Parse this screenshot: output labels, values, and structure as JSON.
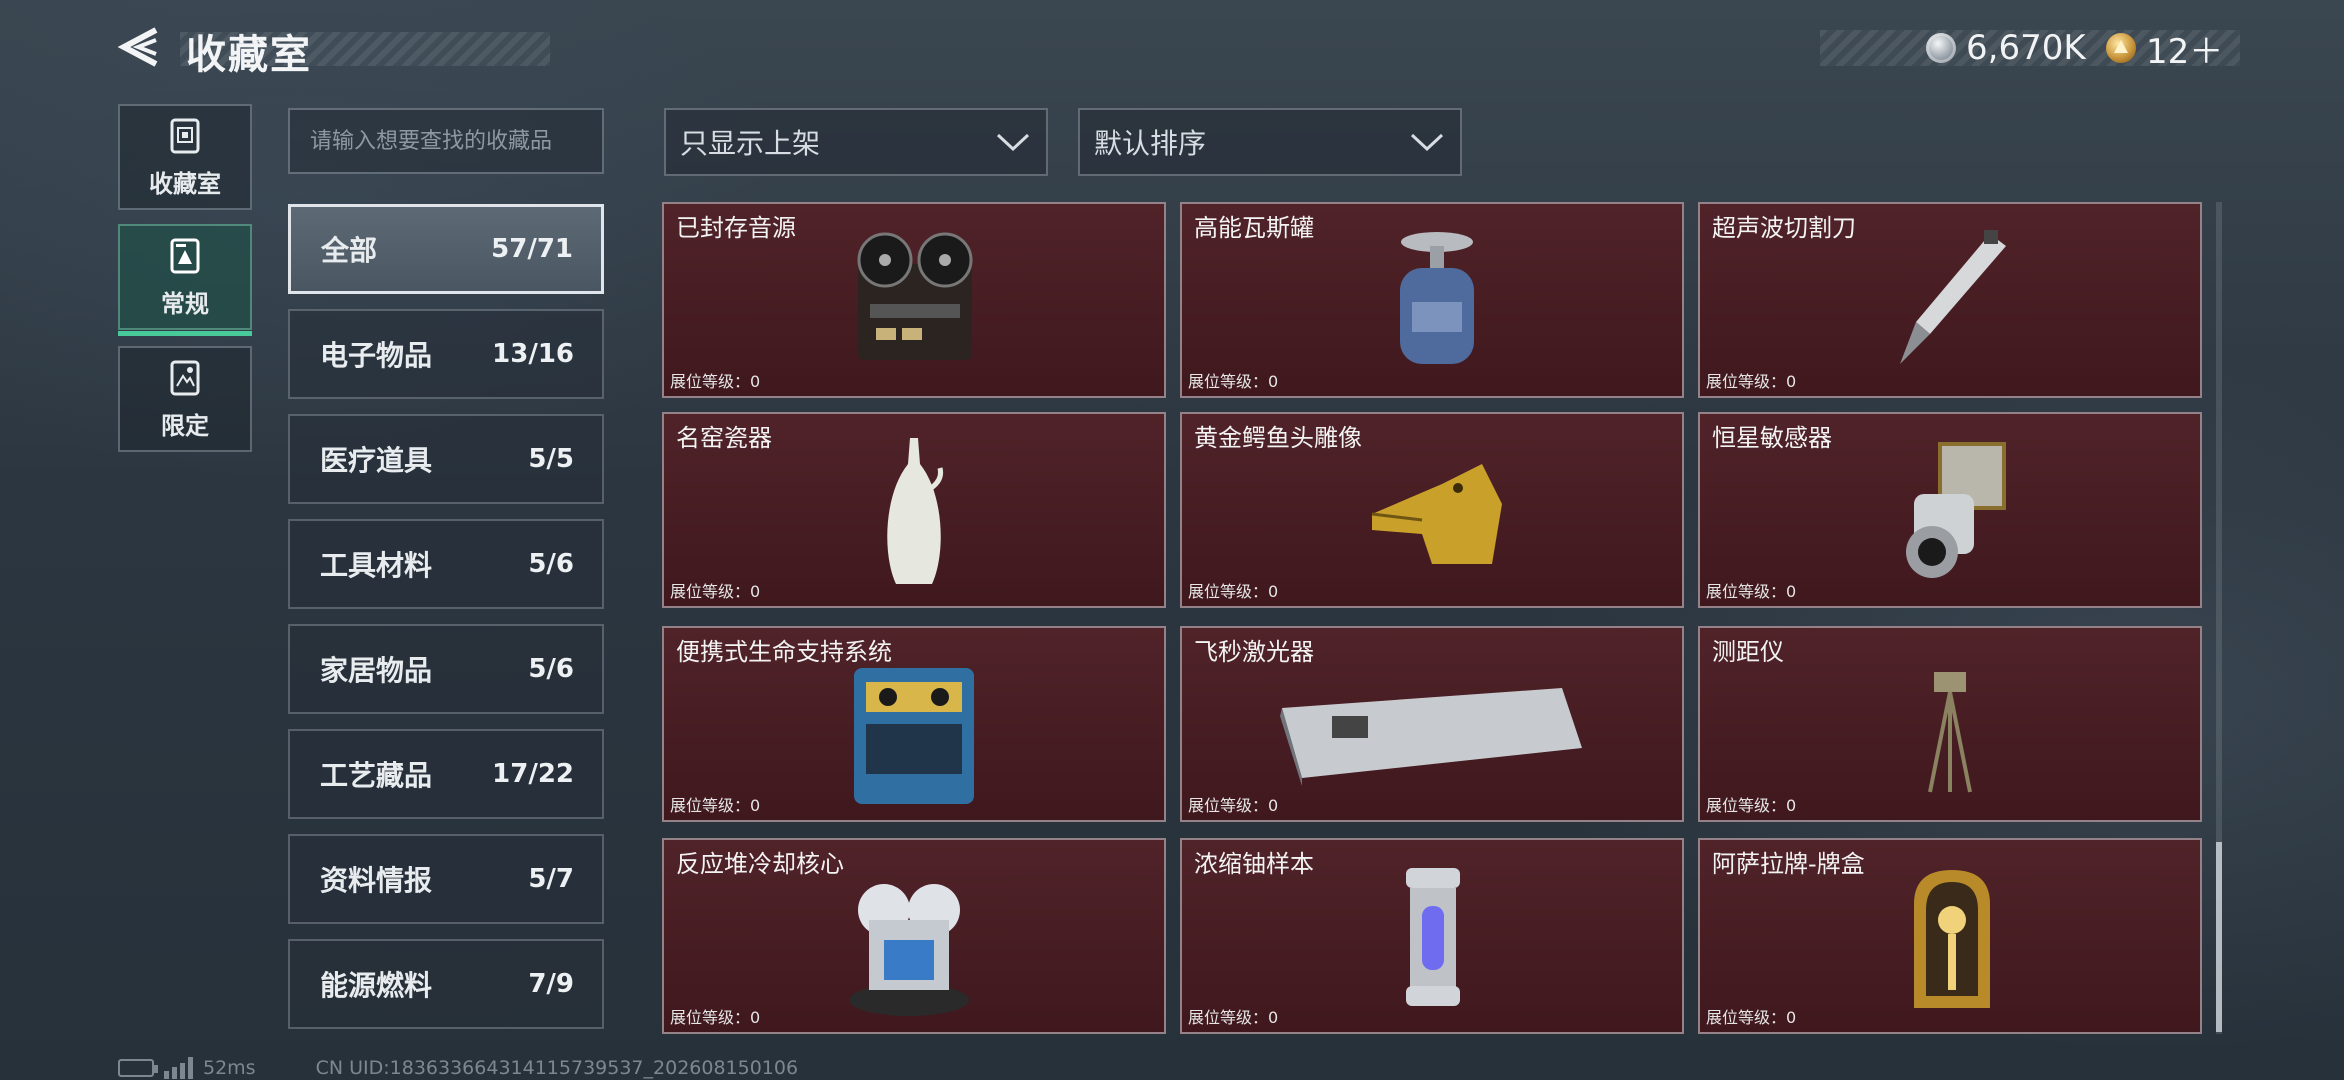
{
  "header": {
    "title": "收藏室",
    "currency_silver": "6,670K",
    "currency_gold": "12＋"
  },
  "nav": [
    {
      "label": "收藏室",
      "icon": "collection-room-icon"
    },
    {
      "label": "常规",
      "icon": "regular-icon",
      "active": true
    },
    {
      "label": "限定",
      "icon": "limited-icon"
    }
  ],
  "search": {
    "placeholder": "请输入想要查找的收藏品"
  },
  "filters": {
    "display_filter": "只显示上架",
    "sort_order": "默认排序"
  },
  "categories": [
    {
      "label": "全部",
      "count": "57/71",
      "active": true
    },
    {
      "label": "电子物品",
      "count": "13/16"
    },
    {
      "label": "医疗道具",
      "count": "5/5"
    },
    {
      "label": "工具材料",
      "count": "5/6"
    },
    {
      "label": "家居物品",
      "count": "5/6"
    },
    {
      "label": "工艺藏品",
      "count": "17/22"
    },
    {
      "label": "资料情报",
      "count": "5/7"
    },
    {
      "label": "能源燃料",
      "count": "7/9"
    }
  ],
  "items": [
    {
      "name": "已封存音源",
      "level": "展位等级：0",
      "icon": "reel-to-reel-recorder-icon"
    },
    {
      "name": "高能瓦斯罐",
      "level": "展位等级：0",
      "icon": "gas-canister-icon"
    },
    {
      "name": "超声波切割刀",
      "level": "展位等级：0",
      "icon": "ultrasonic-cutter-icon"
    },
    {
      "name": "名窑瓷器",
      "level": "展位等级：0",
      "icon": "porcelain-vase-icon"
    },
    {
      "name": "黄金鳄鱼头雕像",
      "level": "展位等级：0",
      "icon": "golden-crocodile-statue-icon"
    },
    {
      "name": "恒星敏感器",
      "level": "展位等级：0",
      "icon": "star-sensor-icon"
    },
    {
      "name": "便携式生命支持系统",
      "level": "展位等级：0",
      "icon": "life-support-system-icon"
    },
    {
      "name": "飞秒激光器",
      "level": "展位等级：0",
      "icon": "femtosecond-laser-icon"
    },
    {
      "name": "测距仪",
      "level": "展位等级：0",
      "icon": "rangefinder-icon"
    },
    {
      "name": "反应堆冷却核心",
      "level": "展位等级：0",
      "icon": "reactor-cooling-core-icon"
    },
    {
      "name": "浓缩铀样本",
      "level": "展位等级：0",
      "icon": "uranium-sample-icon"
    },
    {
      "name": "阿萨拉牌-牌盒",
      "level": "展位等级：0",
      "icon": "asala-card-box-icon"
    }
  ],
  "footer": {
    "ping": "52ms",
    "uid": "CN UID:183633664314115739537_202608150106"
  }
}
